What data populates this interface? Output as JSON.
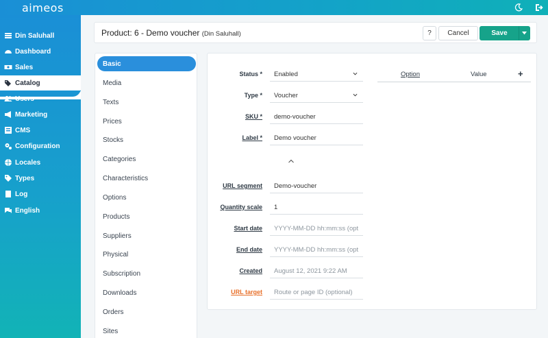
{
  "app": {
    "logo": "aimeos"
  },
  "sidebar": {
    "items": [
      {
        "label": "Din Saluhall",
        "icon": "list-icon"
      },
      {
        "label": "Dashboard",
        "icon": "dashboard-icon"
      },
      {
        "label": "Sales",
        "icon": "money-icon"
      },
      {
        "label": "Catalog",
        "icon": "tags-icon"
      },
      {
        "label": "Users",
        "icon": "users-icon"
      },
      {
        "label": "Marketing",
        "icon": "megaphone-icon"
      },
      {
        "label": "CMS",
        "icon": "cms-icon"
      },
      {
        "label": "Configuration",
        "icon": "cogs-icon"
      },
      {
        "label": "Locales",
        "icon": "globe-icon"
      },
      {
        "label": "Types",
        "icon": "tag-icon"
      },
      {
        "label": "Log",
        "icon": "log-icon"
      },
      {
        "label": "English",
        "icon": "language-icon"
      }
    ]
  },
  "header": {
    "title": "Product: 6 - Demo voucher",
    "subtitle": "(Din Saluhall)",
    "help_label": "?",
    "cancel_label": "Cancel",
    "save_label": "Save"
  },
  "subnav": {
    "items": [
      "Basic",
      "Media",
      "Texts",
      "Prices",
      "Stocks",
      "Categories",
      "Characteristics",
      "Options",
      "Products",
      "Suppliers",
      "Physical",
      "Subscription",
      "Downloads",
      "Orders",
      "Sites"
    ]
  },
  "form": {
    "status": {
      "label": "Status *",
      "value": "Enabled"
    },
    "type": {
      "label": "Type *",
      "value": "Voucher"
    },
    "sku": {
      "label": "SKU *",
      "value": "demo-voucher"
    },
    "label": {
      "label": "Label *",
      "value": "Demo voucher"
    },
    "url_segment": {
      "label": "URL segment",
      "value": "Demo-voucher"
    },
    "quantity_scale": {
      "label": "Quantity scale",
      "value": "1"
    },
    "start_date": {
      "label": "Start date",
      "placeholder": "YYYY-MM-DD hh:mm:ss (opt"
    },
    "end_date": {
      "label": "End date",
      "placeholder": "YYYY-MM-DD hh:mm:ss (opt"
    },
    "created": {
      "label": "Created",
      "value": "August 12, 2021 9:22 AM"
    },
    "url_target": {
      "label": "URL target",
      "placeholder": "Route or page ID (optional)"
    }
  },
  "options_table": {
    "col_option": "Option",
    "col_value": "Value",
    "add_label": "+"
  },
  "colors": {
    "accent": "#2a8fdc",
    "save": "#16a38a",
    "sidebar_top": "#1a8fd6",
    "sidebar_bottom": "#12b3b6",
    "url_target": "#e8702a"
  }
}
